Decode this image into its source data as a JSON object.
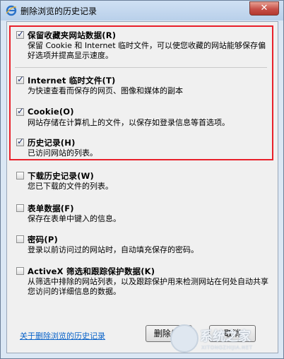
{
  "window": {
    "title": "删除浏览的历史记录",
    "close_label": "✕"
  },
  "options": [
    {
      "label": "保留收藏夹网站数据(R)",
      "desc": "保留 Cookie 和 Internet 临时文件，可以使您收藏的网站能够保存偏好选项并提高显示速度。",
      "checked": true
    },
    {
      "label": "Internet 临时文件(T)",
      "desc": "为快速查看而保存的网页、图像和媒体的副本",
      "checked": true
    },
    {
      "label": "Cookie(O)",
      "desc": "网站存储在计算机上的文件，以保存如登录信息等首选项。",
      "checked": true
    },
    {
      "label": "历史记录(H)",
      "desc": "已访问网站的列表。",
      "checked": true
    },
    {
      "label": "下载历史记录(W)",
      "desc": "您已下载的文件的列表。",
      "checked": false
    },
    {
      "label": "表单数据(F)",
      "desc": "保存在表单中键入的信息。",
      "checked": false
    },
    {
      "label": "密码(P)",
      "desc": "登录以前访问过的网站时，自动填充保存的密码。",
      "checked": false
    },
    {
      "label": "ActiveX 筛选和跟踪保护数据(K)",
      "desc": "从筛选中排除的网站列表，以及跟踪保护用来检测网站在何处自动共享您访问的详细信息的数据。",
      "checked": false
    }
  ],
  "footer": {
    "link": "关于删除浏览的历史记录",
    "delete_label": "删除(D)",
    "cancel_label": "取消"
  },
  "watermark": {
    "text": "系统之家",
    "sub": "XITONGZHIJIA.NET"
  }
}
